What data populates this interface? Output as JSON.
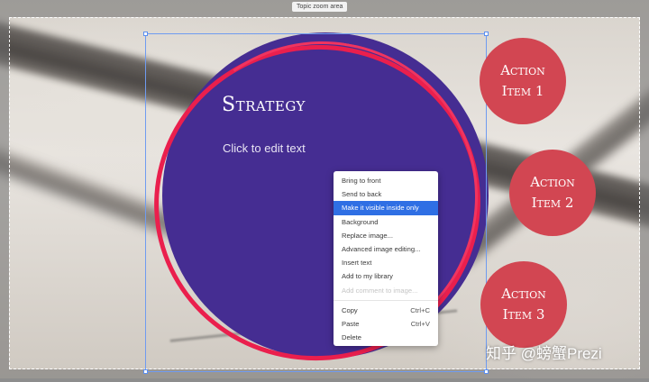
{
  "zoom_area": {
    "label": "Topic zoom area"
  },
  "main_topic": {
    "title": "Strategy",
    "body_placeholder": "Click to edit text"
  },
  "action_items": [
    {
      "line1": "Action",
      "line2": "Item 1"
    },
    {
      "line1": "Action",
      "line2": "Item 2"
    },
    {
      "line1": "Action",
      "line2": "Item 3"
    }
  ],
  "context_menu": {
    "items": [
      {
        "label": "Bring to front"
      },
      {
        "label": "Send to back"
      },
      {
        "label": "Make it visible inside only",
        "state": "highlighted"
      },
      {
        "label": "Background"
      },
      {
        "label": "Replace image..."
      },
      {
        "label": "Advanced image editing..."
      },
      {
        "label": "Insert text"
      },
      {
        "label": "Add to my library"
      },
      {
        "label": "Add comment to image...",
        "state": "disabled"
      },
      {
        "label": "Copy",
        "shortcut": "Ctrl+C"
      },
      {
        "label": "Paste",
        "shortcut": "Ctrl+V"
      },
      {
        "label": "Delete"
      }
    ]
  },
  "watermark": "知乎 @螃蟹Prezi",
  "colors": {
    "main_circle": "#452d92",
    "ring": "#ea1f4d",
    "action_circle": "#d24652",
    "menu_highlight": "#2f6fe4",
    "selection_border": "#6f9bf0"
  }
}
